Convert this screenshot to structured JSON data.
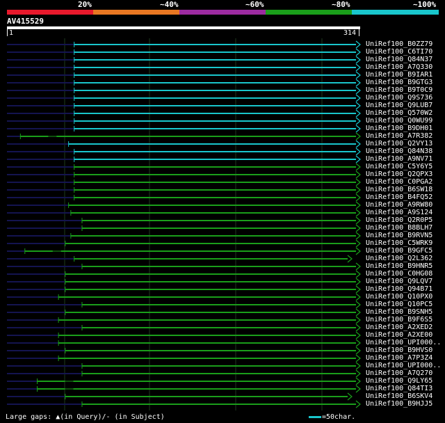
{
  "scale": {
    "labels": [
      "20%",
      "~40%",
      "~60%",
      "~80%",
      "~100%"
    ],
    "colors": [
      "#e8192c",
      "#e87722",
      "#9c2ba0",
      "#1a9e1a",
      "#19c6cc"
    ]
  },
  "query": {
    "title": "AV415529",
    "start": "1",
    "end": "314"
  },
  "hits": [
    {
      "label": "UniRef100_B0ZZ79",
      "start": 60,
      "color": "cyan"
    },
    {
      "label": "UniRef100_C6TI70",
      "start": 60,
      "color": "cyan"
    },
    {
      "label": "UniRef100_Q84N37",
      "start": 60,
      "color": "cyan"
    },
    {
      "label": "UniRef100_A7Q330",
      "start": 60,
      "color": "cyan"
    },
    {
      "label": "UniRef100_B9IAR1",
      "start": 60,
      "color": "cyan"
    },
    {
      "label": "UniRef100_B9GTG3",
      "start": 60,
      "color": "cyan"
    },
    {
      "label": "UniRef100_B9T0C9",
      "start": 60,
      "color": "cyan"
    },
    {
      "label": "UniRef100_Q9S736",
      "start": 60,
      "color": "cyan"
    },
    {
      "label": "UniRef100_Q9LUB7",
      "start": 60,
      "color": "cyan"
    },
    {
      "label": "UniRef100_Q570W2",
      "start": 60,
      "color": "cyan"
    },
    {
      "label": "UniRef100_Q0WU99",
      "start": 60,
      "color": "cyan"
    },
    {
      "label": "UniRef100_B9DH01",
      "start": 60,
      "color": "cyan"
    },
    {
      "label": "UniRef100_A7R382",
      "start": 12,
      "color": "green",
      "gap": true,
      "dark_end": 12
    },
    {
      "label": "UniRef100_Q2VY13",
      "start": 55,
      "color": "cyan",
      "dark_end": 55,
      "gap_at": 60
    },
    {
      "label": "UniRef100_Q84N38",
      "start": 60,
      "color": "cyan"
    },
    {
      "label": "UniRef100_A9NV71",
      "start": 60,
      "color": "cyan"
    },
    {
      "label": "UniRef100_C5Y6Y5",
      "start": 60,
      "color": "green"
    },
    {
      "label": "UniRef100_Q2QPX3",
      "start": 60,
      "color": "green"
    },
    {
      "label": "UniRef100_C0PGA2",
      "start": 60,
      "color": "green"
    },
    {
      "label": "UniRef100_B6SW18",
      "start": 60,
      "color": "green"
    },
    {
      "label": "UniRef100_B4FQ52",
      "start": 60,
      "color": "green"
    },
    {
      "label": "UniRef100_A9RW80",
      "start": 55,
      "color": "green"
    },
    {
      "label": "UniRef100_A9S124",
      "start": 57,
      "color": "green"
    },
    {
      "label": "UniRef100_Q2R0P5",
      "start": 67,
      "color": "green"
    },
    {
      "label": "UniRef100_B8BLH7",
      "start": 67,
      "color": "green"
    },
    {
      "label": "UniRef100_B9RVN5",
      "start": 57,
      "color": "green"
    },
    {
      "label": "UniRef100_C5WRK9",
      "start": 52,
      "color": "green",
      "dark_end": 52
    },
    {
      "label": "UniRef100_B9GFC5",
      "start": 16,
      "color": "green",
      "dark_end": 16,
      "gap": true
    },
    {
      "label": "UniRef100_Q2L362",
      "start": 60,
      "color": "green",
      "dark_end": 51,
      "end_short": true
    },
    {
      "label": "UniRef100_B9HNR5",
      "start": 67,
      "color": "green"
    },
    {
      "label": "UniRef100_C0HG08",
      "start": 52,
      "color": "green",
      "dark_end": 52
    },
    {
      "label": "UniRef100_Q9LQV7",
      "start": 52,
      "color": "green",
      "dark_end": 52
    },
    {
      "label": "UniRef100_Q94B71",
      "start": 52,
      "color": "green",
      "dark_end": 52
    },
    {
      "label": "UniRef100_Q10PX0",
      "start": 46,
      "color": "green",
      "dark_end": 46
    },
    {
      "label": "UniRef100_Q10PC5",
      "start": 67,
      "color": "green"
    },
    {
      "label": "UniRef100_B9SNH5",
      "start": 52,
      "color": "green",
      "dark_end": 52
    },
    {
      "label": "UniRef100_B9F6S5",
      "start": 46,
      "color": "green",
      "dark_end": 46
    },
    {
      "label": "UniRef100_A2XED2",
      "start": 67,
      "color": "green"
    },
    {
      "label": "UniRef100_A2XE00",
      "start": 46,
      "color": "green",
      "dark_end": 46
    },
    {
      "label": "UniRef100_UPI000..",
      "start": 46,
      "color": "green",
      "dark_end": 46
    },
    {
      "label": "UniRef100_B9HVS0",
      "start": 52,
      "color": "green",
      "dark_end": 52
    },
    {
      "label": "UniRef100_A7P3Z4",
      "start": 46,
      "color": "green",
      "dark_end": 46
    },
    {
      "label": "UniRef100_UPI000..",
      "start": 67,
      "color": "green"
    },
    {
      "label": "UniRef100_A7Q270",
      "start": 67,
      "color": "green"
    },
    {
      "label": "UniRef100_Q9LY65",
      "start": 27,
      "color": "green",
      "dark_end": 27,
      "gap": true
    },
    {
      "label": "UniRef100_Q84TI3",
      "start": 27,
      "color": "green",
      "dark_end": 27,
      "gap": true
    },
    {
      "label": "UniRef100_B6SKV4",
      "start": 52,
      "color": "green",
      "dark_end": 52,
      "end_short": true
    },
    {
      "label": "UniRef100_B9HJJ5",
      "start": 67,
      "color": "green"
    }
  ],
  "footer": {
    "legend_text": "Large gaps: ▲(in Query)/- (in Subject)",
    "scale_text": "=50char."
  },
  "colors": {
    "cyan": "#19c6cc",
    "green": "#1a9e1a",
    "dark_line": "#141450",
    "grid": "#1e3a1e"
  }
}
